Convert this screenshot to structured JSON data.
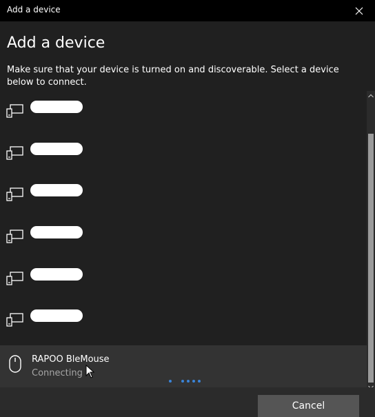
{
  "window": {
    "title": "Add a device"
  },
  "heading": "Add a device",
  "description": "Make sure that your device is turned on and discoverable. Select a device below to connect.",
  "devices": [
    {
      "name_redacted": true,
      "icon": "display-device-icon"
    },
    {
      "name_redacted": true,
      "icon": "display-device-icon"
    },
    {
      "name_redacted": true,
      "icon": "display-device-icon"
    },
    {
      "name_redacted": true,
      "icon": "display-device-icon"
    },
    {
      "name_redacted": true,
      "icon": "display-device-icon"
    },
    {
      "name_redacted": true,
      "icon": "display-device-icon"
    }
  ],
  "selected_device": {
    "name": "RAPOO BleMouse",
    "status": "Connecting",
    "icon": "mouse-icon"
  },
  "footer": {
    "cancel_label": "Cancel"
  },
  "colors": {
    "titlebar": "#000000",
    "background": "#202020",
    "selected_row": "#333333",
    "accent_dots": "#3a84d8",
    "button": "#555555"
  }
}
